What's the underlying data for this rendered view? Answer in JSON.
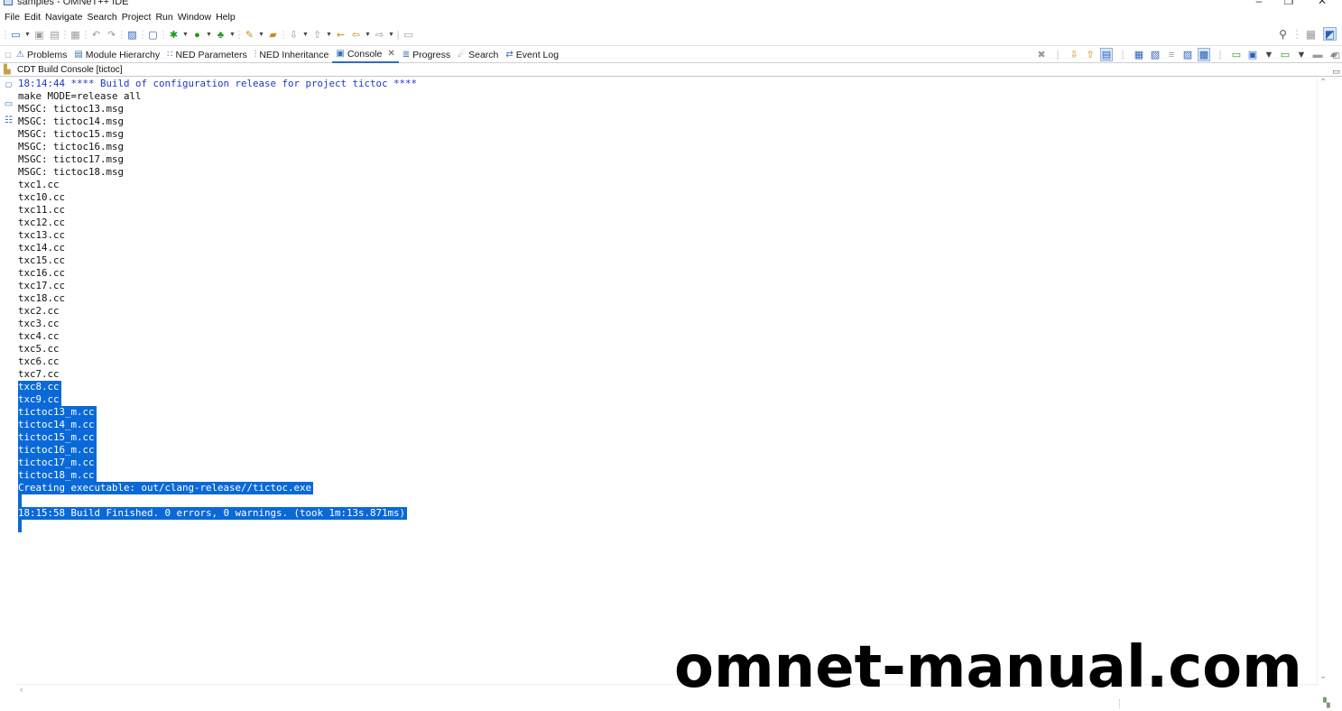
{
  "window": {
    "title": "samples - OMNeT++ IDE",
    "minimize_glyph": "–",
    "maximize_glyph": "❐",
    "close_glyph": "✕"
  },
  "menu": [
    "File",
    "Edit",
    "Navigate",
    "Search",
    "Project",
    "Run",
    "Window",
    "Help"
  ],
  "tabs": [
    {
      "label": "Problems",
      "icon": "problems-icon",
      "glyph": "⚠"
    },
    {
      "label": "Module Hierarchy",
      "icon": "module-hierarchy-icon",
      "glyph": "▤"
    },
    {
      "label": "NED Parameters",
      "icon": "ned-parameters-icon",
      "glyph": "∷"
    },
    {
      "label": "NED Inheritance",
      "icon": "ned-inheritance-icon",
      "glyph": "⫶"
    },
    {
      "label": "Console",
      "icon": "console-icon",
      "glyph": "▣",
      "active": true,
      "close": "✕"
    },
    {
      "label": "Progress",
      "icon": "progress-icon",
      "glyph": "≣"
    },
    {
      "label": "Search",
      "icon": "search-icon",
      "glyph": "☄"
    },
    {
      "label": "Event Log",
      "icon": "event-log-icon",
      "glyph": "⇄"
    }
  ],
  "console": {
    "header": "CDT Build Console [tictoc]",
    "lines": [
      {
        "text": "18:14:44 **** Build of configuration release for project tictoc ****",
        "type": "info"
      },
      {
        "text": "make MODE=release all",
        "type": "normal"
      },
      {
        "text": "MSGC: tictoc13.msg",
        "type": "normal"
      },
      {
        "text": "MSGC: tictoc14.msg",
        "type": "normal"
      },
      {
        "text": "MSGC: tictoc15.msg",
        "type": "normal"
      },
      {
        "text": "MSGC: tictoc16.msg",
        "type": "normal"
      },
      {
        "text": "MSGC: tictoc17.msg",
        "type": "normal"
      },
      {
        "text": "MSGC: tictoc18.msg",
        "type": "normal"
      },
      {
        "text": "txc1.cc",
        "type": "normal"
      },
      {
        "text": "txc10.cc",
        "type": "normal"
      },
      {
        "text": "txc11.cc",
        "type": "normal"
      },
      {
        "text": "txc12.cc",
        "type": "normal"
      },
      {
        "text": "txc13.cc",
        "type": "normal"
      },
      {
        "text": "txc14.cc",
        "type": "normal"
      },
      {
        "text": "txc15.cc",
        "type": "normal"
      },
      {
        "text": "txc16.cc",
        "type": "normal"
      },
      {
        "text": "txc17.cc",
        "type": "normal"
      },
      {
        "text": "txc18.cc",
        "type": "normal"
      },
      {
        "text": "txc2.cc",
        "type": "normal"
      },
      {
        "text": "txc3.cc",
        "type": "normal"
      },
      {
        "text": "txc4.cc",
        "type": "normal"
      },
      {
        "text": "txc5.cc",
        "type": "normal"
      },
      {
        "text": "txc6.cc",
        "type": "normal"
      },
      {
        "text": "txc7.cc",
        "type": "normal"
      },
      {
        "text": "txc8.cc",
        "type": "sel"
      },
      {
        "text": "txc9.cc",
        "type": "sel"
      },
      {
        "text": "tictoc13_m.cc",
        "type": "sel"
      },
      {
        "text": "tictoc14_m.cc",
        "type": "sel"
      },
      {
        "text": "tictoc15_m.cc",
        "type": "sel"
      },
      {
        "text": "tictoc16_m.cc",
        "type": "sel"
      },
      {
        "text": "tictoc17_m.cc",
        "type": "sel"
      },
      {
        "text": "tictoc18_m.cc",
        "type": "sel"
      },
      {
        "text": "Creating executable: out/clang-release//tictoc.exe",
        "type": "sel"
      },
      {
        "text": "",
        "type": "sel-empty"
      },
      {
        "text": "18:15:58 Build Finished. 0 errors, 0 warnings. (took 1m:13s.871ms)",
        "type": "sel"
      },
      {
        "text": "",
        "type": "sel-empty"
      }
    ]
  },
  "watermark": "omnet-manual.com",
  "colors": {
    "selection": "#0a69d8",
    "info_text": "#1f37c8",
    "active_tab": "#2b6ec6"
  }
}
